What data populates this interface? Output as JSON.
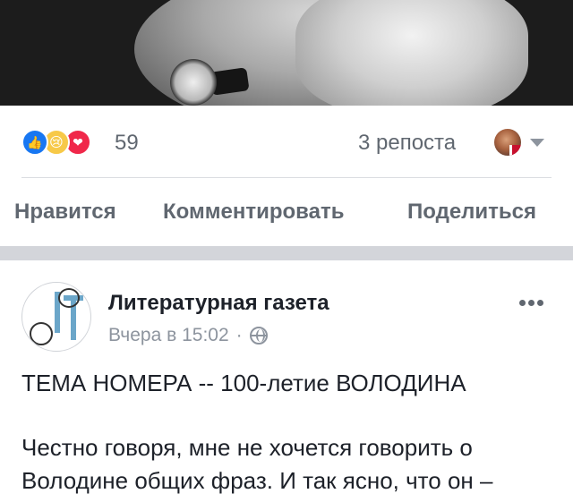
{
  "prev_post": {
    "reactions": {
      "icons": [
        "like-icon",
        "sad-icon",
        "love-icon"
      ],
      "count": "59"
    },
    "shares": "3 репоста",
    "actions": {
      "like": "Нравится",
      "comment": "Комментировать",
      "share": "Поделиться"
    },
    "colors": {
      "like": "#1877f2",
      "sad": "#f7c948",
      "love": "#f0284a"
    }
  },
  "post": {
    "page_name": "Литературная газета",
    "timestamp": "Вчера в 15:02",
    "separator": "·",
    "privacy_icon": "globe-icon",
    "headline": "ТЕМА НОМЕРА -- 100-летие ВОЛОДИНА",
    "body_line1": "Честно говоря, мне не хочется говорить о",
    "body_line2": "Володине общих фраз. И так ясно, что он –"
  }
}
